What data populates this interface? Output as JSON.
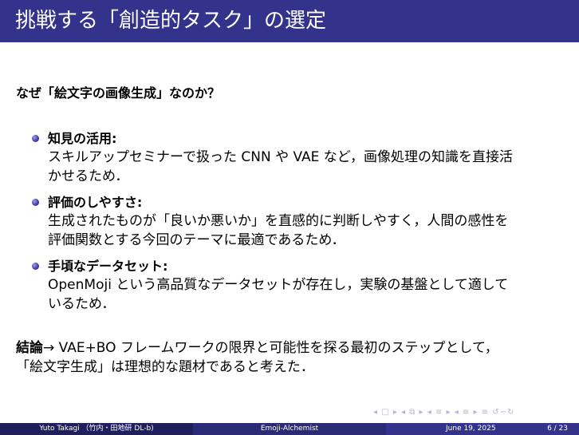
{
  "slide": {
    "title": "挑戦する「創造的タスク」の選定",
    "subheading": "なぜ「絵文字の画像生成」なのか？",
    "items": [
      {
        "label": "知見の活用:",
        "lines": [
          "スキルアップセミナーで扱った CNN や VAE など，画像処理の知識を直接活",
          "かせるため．"
        ]
      },
      {
        "label": "評価のしやすさ:",
        "lines": [
          "生成されたものが「良いか悪いか」を直感的に判断しやすく，人間の感性を",
          "評価関数とする今回のテーマに最適であるため．"
        ]
      },
      {
        "label": "手頃なデータセット:",
        "lines": [
          "OpenMoji という高品質なデータセットが存在し，実験の基盤として適して",
          "いるため．"
        ]
      }
    ],
    "conclusion": {
      "label": "結論",
      "arrow": "→",
      "line1": " VAE+BO フレームワークの限界と可能性を探る最初のステップとして，",
      "line2": "「絵文字生成」は理想的な題材であると考えた．"
    }
  },
  "nav": {
    "symbols": "◂ □ ▸  ◂ ⧉ ▸  ◂ ≡ ▸  ◂ ≡ ▸   ≡   ↺∽↻"
  },
  "footer": {
    "author": "Yuto Takagi （竹内・田地研 DL-b)",
    "short_title": "Emoji-Alchemist",
    "date": "June 19, 2025",
    "page": "6 / 23"
  },
  "colors": {
    "title_bar": "#33338c",
    "footer_dark": "#1f1f5c",
    "footer_mid": "#2a2a75",
    "footer_light": "#33338c"
  }
}
